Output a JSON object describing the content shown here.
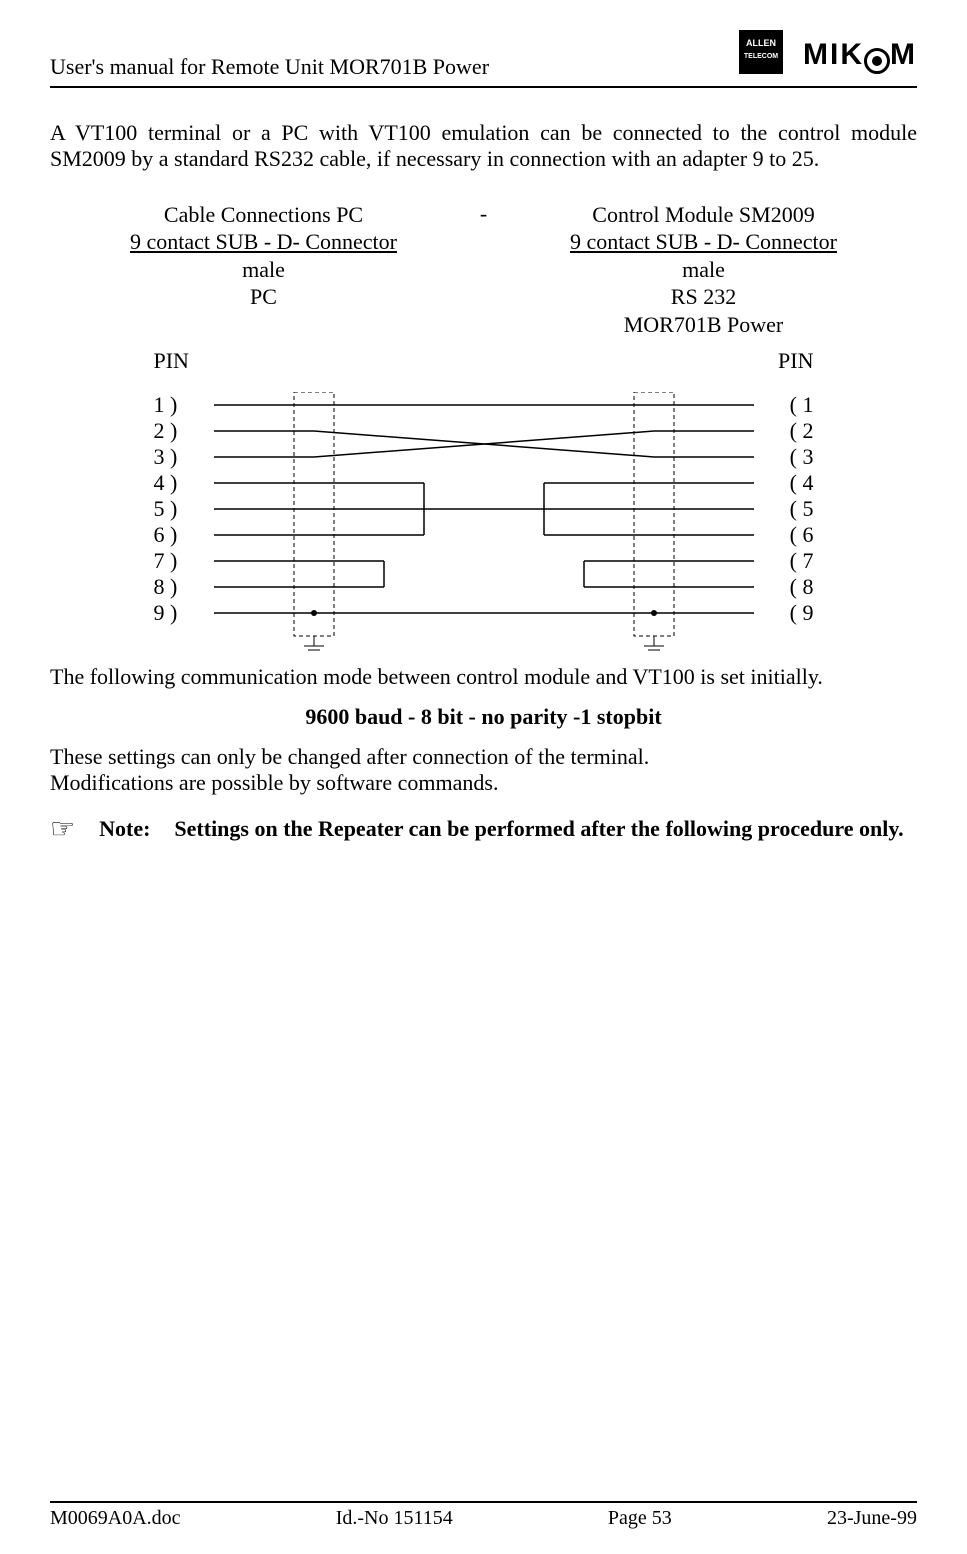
{
  "header": {
    "title": "User's manual for Remote Unit MOR701B Power",
    "logo_allen_top": "ALLEN",
    "logo_allen_bottom": "TELECOM",
    "logo_mikom_pre": "MIK",
    "logo_mikom_post": "M"
  },
  "intro": "A VT100 terminal or a PC with VT100 emulation can be connected to the control module SM2009 by a standard RS232 cable, if necessary in connection with an adapter 9 to 25.",
  "cable": {
    "left": {
      "line1": "Cable Connections PC",
      "line2": "9 contact SUB - D- Connector",
      "line3": "male",
      "line4": "PC"
    },
    "sep": "-",
    "right": {
      "line1": "Control Module SM2009",
      "line2": "9 contact SUB - D- Connector",
      "line3": "male",
      "line4": "RS 232",
      "line5": "MOR701B Power"
    },
    "pin_label": "PIN"
  },
  "pins": {
    "left": [
      "1  )",
      "2  )",
      "3  )",
      "4  )",
      "5  )",
      "6  )",
      "7  )",
      "8  )",
      "9  )"
    ],
    "right": [
      "(  1",
      "(  2",
      "(  3",
      "(  4",
      "(  5",
      "(  6",
      "(  7",
      "(  8",
      "(  9"
    ]
  },
  "comm_mode": "The following communication mode between control module and VT100 is set initially.",
  "baud": "9600 baud - 8 bit - no parity -1 stopbit",
  "settings": {
    "l1": "These settings can only be changed after connection of the terminal.",
    "l2": "Modifications are possible by software commands."
  },
  "note": {
    "icon": "☞",
    "label": "Note:",
    "text": "Settings on the Repeater can be performed after the following procedure only."
  },
  "footer": {
    "doc": "M0069A0A.doc",
    "id": "Id.-No 151154",
    "page": "Page 53",
    "date": "23-June-99"
  }
}
